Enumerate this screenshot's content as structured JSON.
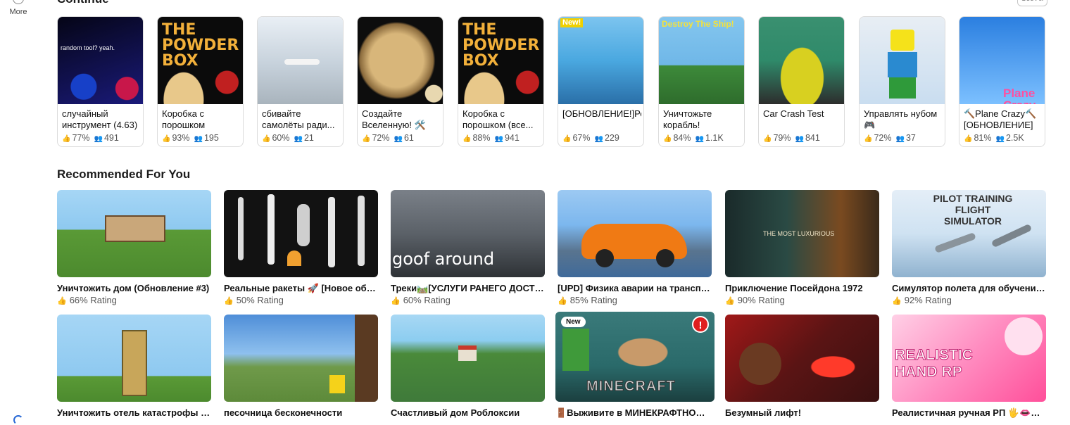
{
  "sidebar": {
    "more_label": "More"
  },
  "continue": {
    "title": "Continue",
    "see_all": "See All",
    "items": [
      {
        "title": "случайный инструмент (4.63)",
        "rating": "77%",
        "players": "491",
        "thumb_text": "random tool?  yeah.",
        "colors": [
          "#050516",
          "#1a1a7a"
        ]
      },
      {
        "title": "Коробка с порошком",
        "rating": "93%",
        "players": "195",
        "thumb_text": "THE POWDER BOX",
        "colors": [
          "#0b0b0b",
          "#2a1a08"
        ]
      },
      {
        "title": "сбивайте самолёты ради...",
        "rating": "60%",
        "players": "21",
        "thumb_text": "",
        "colors": [
          "#cdd9e6",
          "#9aa7b2"
        ]
      },
      {
        "title": "Создайте Вселенную! 🛠️",
        "rating": "72%",
        "players": "61",
        "thumb_text": "",
        "colors": [
          "#0d0d0d",
          "#7a5a30"
        ]
      },
      {
        "title": "Коробка с порошком (все...",
        "rating": "88%",
        "players": "941",
        "thumb_text": "THE POWDER BOX",
        "colors": [
          "#0b0b0b",
          "#2a1a08"
        ]
      },
      {
        "title": "[ОБНОВЛЕНИЕ!]Реалистичный...",
        "rating": "67%",
        "players": "229",
        "thumb_text": "New!",
        "colors": [
          "#4aa8e0",
          "#2a6fa8"
        ]
      },
      {
        "title": "Уничтожьте корабль!",
        "rating": "84%",
        "players": "1.1K",
        "thumb_text": "Destroy The Ship!",
        "colors": [
          "#6fb7e8",
          "#3d8a3a"
        ]
      },
      {
        "title": "Car Crash Test",
        "rating": "79%",
        "players": "841",
        "thumb_text": "",
        "colors": [
          "#2f8a6a",
          "#2d2d2d"
        ]
      },
      {
        "title": "Управлять нубом🎮",
        "rating": "72%",
        "players": "37",
        "thumb_text": "",
        "colors": [
          "#c9ddf0",
          "#e8eef4"
        ]
      },
      {
        "title": "🔨Plane Crazy🔨 [ОБНОВЛЕНИЕ]",
        "rating": "81%",
        "players": "2.5K",
        "thumb_text": "Plane Crazy",
        "colors": [
          "#2b7fe0",
          "#7cc0ff"
        ]
      }
    ]
  },
  "recommended": {
    "title": "Recommended For You",
    "rows": [
      [
        {
          "title": "Уничтожить дом (Обновление #3)",
          "rating": "66% Rating",
          "thumb_text": "",
          "colors": [
            "#8ec9f0",
            "#4c8a2e"
          ]
        },
        {
          "title": "Реальные ракеты 🚀 [Новое обнов...",
          "rating": "50% Rating",
          "thumb_text": "",
          "colors": [
            "#111111",
            "#2a2a2a"
          ]
        },
        {
          "title": "Треки🛤️[УСЛУГИ РАНЕГО ДОСТУПА]",
          "rating": "60% Rating",
          "thumb_text": "goof around",
          "colors": [
            "#5b6168",
            "#2e3236"
          ]
        },
        {
          "title": "[UPD] Физика аварии на транспор...",
          "rating": "85% Rating",
          "thumb_text": "",
          "colors": [
            "#7cb7ee",
            "#3f6a9a"
          ]
        },
        {
          "title": "Приключение Посейдона 1972",
          "rating": "90% Rating",
          "thumb_text": "THE MOST LUXURIOUS",
          "colors": [
            "#1a2a2a",
            "#7a4a20"
          ]
        },
        {
          "title": "Симулятор полета для обучения п...",
          "rating": "92% Rating",
          "thumb_text": "PILOT TRAINING FLIGHT SIMULATOR",
          "colors": [
            "#cfe2f2",
            "#8fb2cf"
          ]
        }
      ],
      [
        {
          "title": "Уничтожить отель катастрофы [Од...",
          "rating": "",
          "thumb_text": "",
          "colors": [
            "#8ec9f0",
            "#4c8a2e"
          ]
        },
        {
          "title": "песочница бесконечности",
          "rating": "",
          "thumb_text": "",
          "colors": [
            "#5fa0e0",
            "#5d8a3a"
          ]
        },
        {
          "title": "Счастливый дом Роблоксии",
          "rating": "",
          "thumb_text": "",
          "colors": [
            "#8ccdf0",
            "#3f7a3a"
          ]
        },
        {
          "title": "🚪Выживите в МИНЕКРАФТНОМ КИ...",
          "rating": "",
          "thumb_text": "MINECRAFT",
          "badge": "New",
          "colors": [
            "#2a6a6a",
            "#1b3f3f"
          ]
        },
        {
          "title": "Безумный лифт!",
          "rating": "",
          "thumb_text": "",
          "colors": [
            "#3a1010",
            "#a01818"
          ]
        },
        {
          "title": "Реалистичная ручная РП 🖐️👄😋 [...",
          "rating": "",
          "thumb_text": "REALISTIC HAND RP",
          "colors": [
            "#ff4f9a",
            "#ffd0e6"
          ]
        }
      ]
    ]
  }
}
